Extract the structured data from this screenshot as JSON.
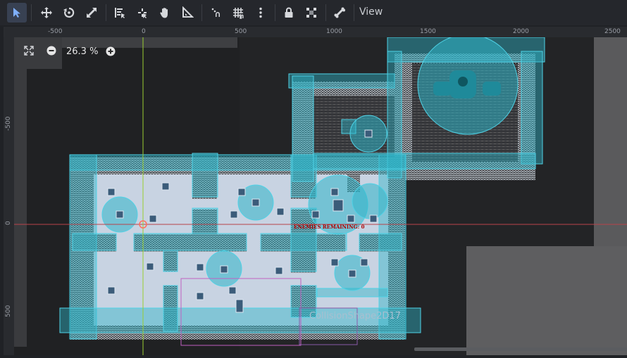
{
  "toolbar": {
    "view_label": "View"
  },
  "zoom": {
    "value": "26.3 %"
  },
  "rulers": {
    "top": [
      "-500",
      "0",
      "500",
      "1000",
      "1500",
      "2000",
      "2500"
    ],
    "left": [
      "-500",
      "0",
      "500"
    ]
  },
  "scene": {
    "overlay_text": "ENEMIES REMAINING: 0",
    "selected_node_label": "CollisionShape2D17"
  },
  "colors": {
    "accent": "#4a90d9",
    "collision": "#2fb4c8",
    "floor": "#c8d3e2",
    "axis_x": "#b8434a",
    "axis_y": "#9acd32"
  }
}
